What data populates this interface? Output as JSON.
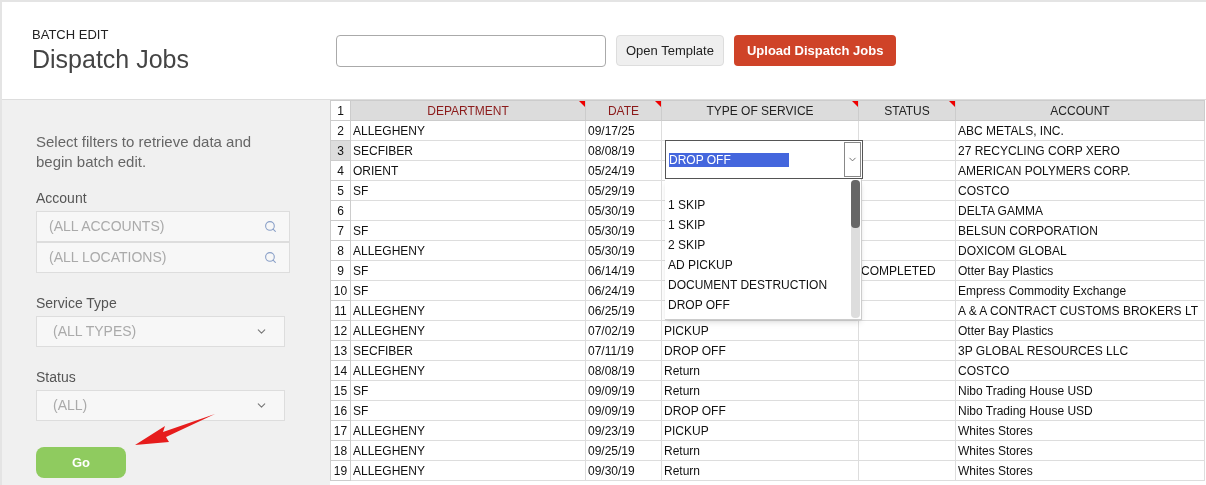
{
  "header": {
    "subtitle": "BATCH EDIT",
    "title": "Dispatch Jobs",
    "file_field": {
      "kind": "file"
    },
    "buttons": [
      {
        "label": "Open Template",
        "kind": "secondary"
      },
      {
        "label": "Upload Dispatch Jobs",
        "kind": "primary"
      }
    ]
  },
  "filters": {
    "intro": "Select filters to retrieve data and begin batch edit.",
    "account_label": "Account",
    "account_placeholder": "(ALL ACCOUNTS)",
    "location_placeholder": "(ALL LOCATIONS)",
    "service_label": "Service Type",
    "service_value": "(ALL TYPES)",
    "status_label": "Status",
    "status_value": "(ALL)",
    "go": "Go"
  },
  "sheet": {
    "header_number": "1",
    "columns": [
      {
        "label": "DEPARTMENT",
        "required": true,
        "flagged": true
      },
      {
        "label": "DATE",
        "required": true,
        "flagged": true
      },
      {
        "label": "TYPE OF SERVICE",
        "required": false,
        "flagged": true
      },
      {
        "label": "STATUS",
        "required": false,
        "flagged": true
      },
      {
        "label": "ACCOUNT",
        "required": false,
        "flagged": false
      }
    ],
    "rows": [
      {
        "number": "2",
        "selected": false,
        "department": "ALLEGHENY",
        "date": "09/17/25",
        "account": "ABC METALS, INC."
      },
      {
        "number": "3",
        "selected": true,
        "department": "SECFIBER",
        "date": "08/08/19",
        "account": "27 RECYCLING CORP XERO"
      },
      {
        "number": "4",
        "selected": false,
        "department": "ORIENT",
        "date": "05/24/19",
        "account": "AMERICAN POLYMERS CORP."
      },
      {
        "number": "5",
        "selected": false,
        "department": "SF",
        "date": "05/29/19",
        "account": "COSTCO"
      },
      {
        "number": "6",
        "selected": false,
        "department": "",
        "date": "05/30/19",
        "account": "DELTA GAMMA"
      },
      {
        "number": "7",
        "selected": false,
        "department": "SF",
        "date": "05/30/19",
        "account": "BELSUN CORPORATION"
      },
      {
        "number": "8",
        "selected": false,
        "department": "ALLEGHENY",
        "date": "05/30/19",
        "account": "DOXICOM GLOBAL"
      },
      {
        "number": "9",
        "selected": false,
        "department": "SF",
        "date": "06/14/19",
        "status": "COMPLETED",
        "account": "Otter Bay Plastics"
      },
      {
        "number": "10",
        "selected": false,
        "department": "SF",
        "date": "06/24/19",
        "account": "Empress Commodity Exchange"
      },
      {
        "number": "11",
        "selected": false,
        "department": "ALLEGHENY",
        "date": "06/25/19",
        "account": "A & A CONTRACT CUSTOMS BROKERS LT"
      },
      {
        "number": "12",
        "selected": false,
        "department": "ALLEGHENY",
        "date": "07/02/19",
        "type": "PICKUP",
        "account": "Otter Bay Plastics"
      },
      {
        "number": "13",
        "selected": false,
        "department": "SECFIBER",
        "date": "07/11/19",
        "type": "DROP OFF",
        "account": "3P GLOBAL RESOURCES LLC"
      },
      {
        "number": "14",
        "selected": false,
        "department": "ALLEGHENY",
        "date": "08/08/19",
        "type": "Return",
        "account": "COSTCO"
      },
      {
        "number": "15",
        "selected": false,
        "department": "SF",
        "date": "09/09/19",
        "type": "Return",
        "account": "Nibo Trading House USD"
      },
      {
        "number": "16",
        "selected": false,
        "department": "SF",
        "date": "09/09/19",
        "type": "DROP OFF",
        "account": "Nibo Trading House USD"
      },
      {
        "number": "17",
        "selected": false,
        "department": "ALLEGHENY",
        "date": "09/23/19",
        "type": "PICKUP",
        "account": "Whites Stores"
      },
      {
        "number": "18",
        "selected": false,
        "department": "ALLEGHENY",
        "date": "09/25/19",
        "type": "Return",
        "account": "Whites Stores"
      },
      {
        "number": "19",
        "selected": false,
        "department": "ALLEGHENY",
        "date": "09/30/19",
        "type": "Return",
        "account": "Whites Stores"
      }
    ],
    "editor": {
      "value": "DROP OFF",
      "options": [
        "1 SKIP",
        "1 SKIP",
        "2 SKIP",
        "AD PICKUP",
        "DOCUMENT DESTRUCTION",
        "DROP OFF"
      ]
    }
  }
}
